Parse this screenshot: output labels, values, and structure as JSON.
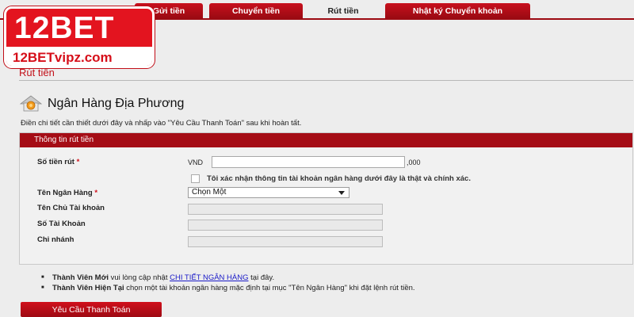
{
  "tabs": [
    {
      "label": "Gửi tiền",
      "active": false
    },
    {
      "label": "Chuyển tiền",
      "active": false
    },
    {
      "label": "Rút tiền",
      "active": true
    },
    {
      "label": "Nhật ký Chuyển khoản",
      "active": false
    }
  ],
  "logo": {
    "wordmark_num": "12",
    "wordmark_txt": "BET",
    "subtext": "12BETvipz.com"
  },
  "page_title": "Rút tiền",
  "section": {
    "title": "Ngân Hàng Địa Phương",
    "icon": "home-bank-icon",
    "instructions": "Điền chi tiết cần thiết dưới đây và nhấp vào \"Yêu Cầu Thanh Toán\" sau khi hoàn tất."
  },
  "form": {
    "header": "Thông tin rút tiền",
    "amount_label": "Số tiền rút",
    "required_mark": "*",
    "currency": "VND",
    "amount_value": "",
    "amount_suffix": ",000",
    "confirm_label": "Tôi xác nhận thông tin tài khoản ngân hàng dưới đây là thật và chính xác.",
    "bank_label": "Tên Ngân Hàng",
    "bank_selected": "Chọn Một",
    "holder_label": "Tên Chủ Tài khoản",
    "account_label": "Số Tài Khoản",
    "branch_label": "Chi nhánh",
    "holder_value": "",
    "account_value": "",
    "branch_value": ""
  },
  "notes": {
    "new_member_bold": "Thành Viên Mới",
    "new_member_text": " vui lòng cập nhật ",
    "new_member_link": "CHI TIẾT NGÂN HÀNG",
    "new_member_tail": " tại đây.",
    "current_member_bold": "Thành Viên Hiện Tại",
    "current_member_text": " chọn một tài khoản ngân hàng mặc định tại mục \"Tên Ngân Hàng\" khi đặt lệnh rút tiền."
  },
  "submit_label": "Yêu Cầu Thanh Toán",
  "colors": {
    "brand_red": "#a50d16",
    "title_red": "#c21019",
    "background": "#ededed"
  }
}
